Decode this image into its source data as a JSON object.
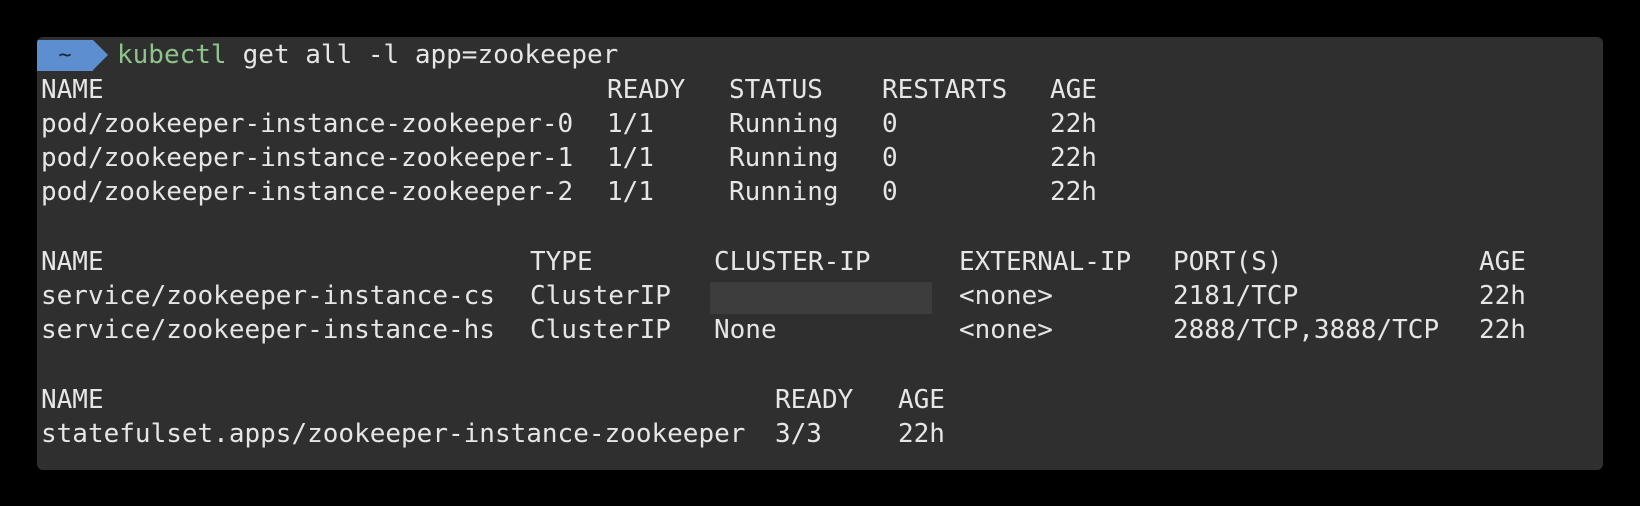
{
  "prompt": {
    "badge": "~",
    "command": "kubectl",
    "args": " get all -l app=zookeeper"
  },
  "pods": {
    "headers": [
      "NAME",
      "READY",
      "STATUS",
      "RESTARTS",
      "AGE"
    ],
    "rows": [
      [
        "pod/zookeeper-instance-zookeeper-0",
        "1/1",
        "Running",
        "0",
        "22h"
      ],
      [
        "pod/zookeeper-instance-zookeeper-1",
        "1/1",
        "Running",
        "0",
        "22h"
      ],
      [
        "pod/zookeeper-instance-zookeeper-2",
        "1/1",
        "Running",
        "0",
        "22h"
      ]
    ]
  },
  "services": {
    "headers": [
      "NAME",
      "TYPE",
      "CLUSTER-IP",
      "EXTERNAL-IP",
      "PORT(S)",
      "AGE"
    ],
    "rows": [
      [
        "service/zookeeper-instance-cs",
        "ClusterIP",
        "",
        "<none>",
        "2181/TCP",
        "22h"
      ],
      [
        "service/zookeeper-instance-hs",
        "ClusterIP",
        "None",
        "<none>",
        "2888/TCP,3888/TCP",
        "22h"
      ]
    ]
  },
  "statefulsets": {
    "headers": [
      "NAME",
      "READY",
      "AGE"
    ],
    "rows": [
      [
        "statefulset.apps/zookeeper-instance-zookeeper",
        "3/3",
        "22h"
      ]
    ]
  }
}
